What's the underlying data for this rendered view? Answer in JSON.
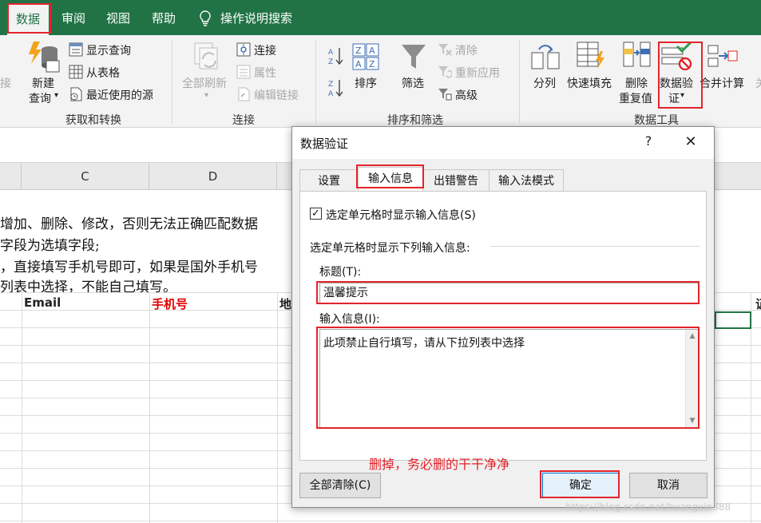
{
  "ribbon_tabs": [
    "数据",
    "审阅",
    "视图",
    "帮助"
  ],
  "tell_me": "操作说明搜索",
  "ribbon": {
    "get_transform": {
      "label": "获取和转换",
      "new_query_line1": "新建",
      "new_query_line2": "查询",
      "show_query": "显示查询",
      "from_table": "从表格",
      "recent_sources": "最近使用的源"
    },
    "connections": {
      "label": "连接",
      "refresh_all": "全部刷新",
      "connections": "连接",
      "properties": "属性",
      "edit_links": "编辑链接"
    },
    "sort_filter": {
      "label": "排序和筛选",
      "sort": "排序",
      "filter": "筛选",
      "clear": "清除",
      "reapply": "重新应用",
      "advanced": "高级"
    },
    "data_tools": {
      "label": "数据工具",
      "split": "分列",
      "flash_fill": "快速填充",
      "remove_dup_line1": "删除",
      "remove_dup_line2": "重复值",
      "validation_line1": "数据验",
      "validation_line2": "证",
      "consolidate": "合并计算"
    },
    "partial_left": "接",
    "partial_right": "关"
  },
  "sheet": {
    "columns": [
      "C",
      "D"
    ],
    "lines": [
      "增加、删除、修改，否则无法正确匹配数据",
      "字段为选填字段;",
      "，直接填写手机号即可，如果是国外手机号",
      "列表中选择，不能自己填写。"
    ],
    "header_email": "Email",
    "header_phone": "手机号",
    "header_addr_partial": "地",
    "header_right_partial": "证"
  },
  "dialog": {
    "title": "数据验证",
    "help": "?",
    "close": "✕",
    "tabs": [
      "设置",
      "输入信息",
      "出错警告",
      "输入法模式"
    ],
    "show_checkbox_label": "选定单元格时显示输入信息(S)",
    "section_label": "选定单元格时显示下列输入信息:",
    "title_label": "标题(T):",
    "title_value": "温馨提示",
    "message_label": "输入信息(I):",
    "message_value": "此项禁止自行填写，请从下拉列表中选择",
    "clear_all": "全部清除(C)",
    "ok": "确定",
    "cancel": "取消"
  },
  "annotation": "删掉，务必删的干干净净",
  "watermark": "https://blog.csdn.net/huangxin388",
  "colors": {
    "ribbon_green": "#217346",
    "annotation_red": "#e3242b",
    "phone_header_red": "#e00000"
  }
}
